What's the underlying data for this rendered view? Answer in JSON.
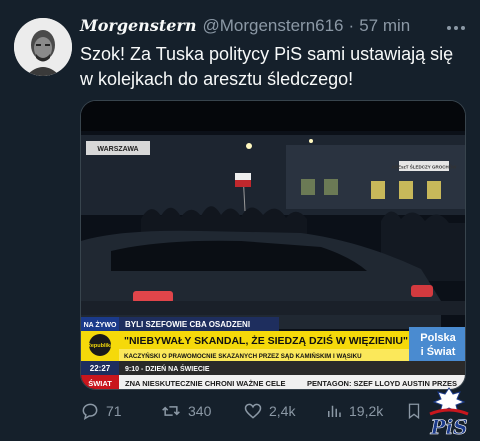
{
  "tweet": {
    "display_name": "Morgenstern",
    "handle": "@Morgenstern616",
    "separator": "·",
    "timestamp": "57 min",
    "text": "Szok! Za Tuska politycy PiS sami ustawiają się w kolejkach do aresztu śledczego!"
  },
  "media": {
    "location_sign": "WARSZAWA",
    "building_sign": "AREszT ŚLEDCZY GROCHÓW",
    "channel_label": "NA ŻYWO",
    "channel_logo": "Republika",
    "kicker": "BYLI SZEFOWIE CBA OSADZENI",
    "headline": "\"NIEBYWAŁY SKANDAL, ŻE SIEDZĄ DZIŚ W WIĘZIENIU\"",
    "subheadline": "KACZYŃSKI O PRAWOMOCNIE SKAZANYCH PRZEZ SĄD KAMIŃSKIM I WĄSIKU",
    "clock": "22:27",
    "program_label": "9:10 - DZIEŃ NA ŚWIECIE",
    "segment_line1": "Polska",
    "segment_line2": "i Świat",
    "ticker_label": "ŚWIAT",
    "ticker_text": "ZNA NIESKUTECZNIE CHRONI WAŻNE CELE",
    "ticker_text_right": "PENTAGON: SZEF LLOYD AUSTIN PRZES"
  },
  "actions": {
    "replies": "71",
    "reposts": "340",
    "likes": "2,4k",
    "views": "19,2k"
  },
  "watermark": {
    "text": "PiS"
  },
  "colors": {
    "background": "#15202b",
    "text_primary": "#f7f9f9",
    "text_secondary": "#8b98a5",
    "ticker_yellow": "#f5d90a",
    "ticker_red": "#c8161d"
  }
}
